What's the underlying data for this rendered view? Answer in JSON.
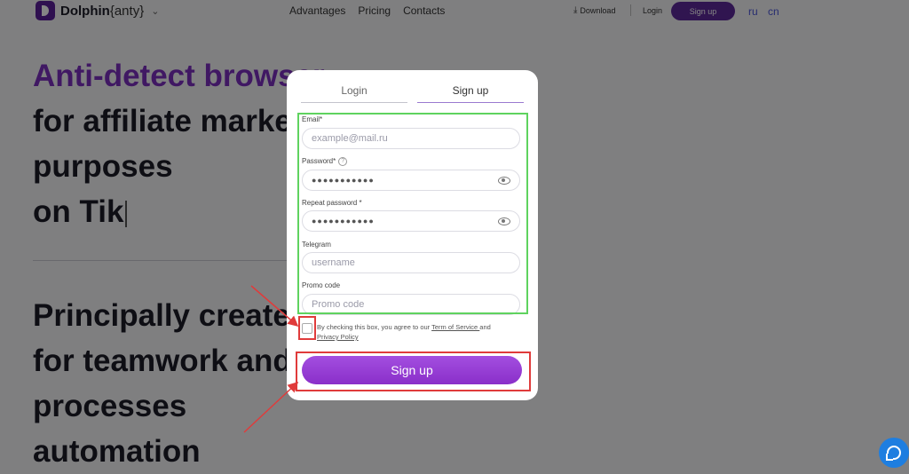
{
  "header": {
    "logo_brand": "Dolphin",
    "logo_suffix": "{anty}",
    "nav": [
      "Advantages",
      "Pricing",
      "Contacts"
    ],
    "download_label": "Download",
    "login_label": "Login",
    "signup_label": "Sign up",
    "lang_ru": "ru",
    "lang_cn": "cn"
  },
  "hero": {
    "line1": "Anti-detect browser",
    "line2": "for affiliate marketing",
    "line3": "purposes",
    "line4": "on Tik"
  },
  "hero2": {
    "line1": "Principally created",
    "line2": "for teamwork and",
    "line3": "processes",
    "line4": "automation"
  },
  "modal": {
    "tab_login": "Login",
    "tab_signup": "Sign up",
    "email_label": "Email*",
    "email_placeholder": "example@mail.ru",
    "password_label": "Password*",
    "password_value": "●●●●●●●●●●●",
    "repeat_label": "Repeat password *",
    "repeat_value": "●●●●●●●●●●●",
    "telegram_label": "Telegram",
    "telegram_placeholder": "username",
    "promo_label": "Promo code",
    "promo_placeholder": "Promo code",
    "agree_text": "By checking this box, you agree to our ",
    "terms_link": "Term of Service ",
    "and_text": "and",
    "privacy_link": "Privacy Policy",
    "signup_button": "Sign up"
  },
  "colors": {
    "accent": "#7b2fbe",
    "button": "#9a3fd6",
    "annotation_green": "#5fd35f",
    "annotation_red": "#e03b3b"
  }
}
